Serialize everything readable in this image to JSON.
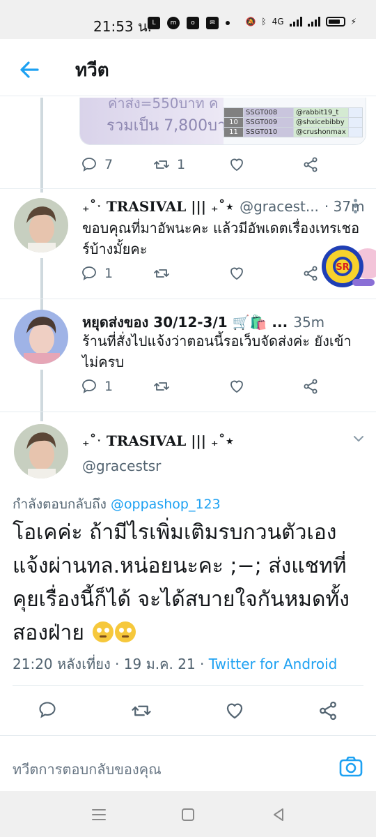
{
  "status_bar": {
    "time": "21:53 น.",
    "network": "4G"
  },
  "app_bar": {
    "title": "ทวีต",
    "back_icon": "arrow-left-icon"
  },
  "media_preview": {
    "text_top": "ค่าส่ง=550บาท ค",
    "text_bottom": "รวมเป็น 7,800บา",
    "rows": [
      {
        "idx": "",
        "code": "SSGT008",
        "user": "@rabbit19_t"
      },
      {
        "idx": "10",
        "code": "SSGT009",
        "user": "@shxicebibby"
      },
      {
        "idx": "11",
        "code": "SSGT010",
        "user": "@crushonmax"
      }
    ]
  },
  "tweets": [
    {
      "actions": {
        "reply": "7",
        "retweet": "1",
        "like": "",
        "share": ""
      }
    },
    {
      "name": "₊˚ˑ TRASIVAL ||| ₊˚⋆",
      "handle": "@gracest...",
      "time": "· 37m",
      "body": "ขอบคุณที่มาอัพนะคะ แล้วมีอัพเดตเรื่องเทรเชอร์บ้างมั้ยคะ",
      "actions": {
        "reply": "1",
        "retweet": "",
        "like": "",
        "share": ""
      }
    },
    {
      "name": "หยุดส่งของ 30/12-3/1 🛒🛍️ ...",
      "handle": "",
      "time": "35m",
      "body": "ร้านที่สั่งไปแจ้งว่าตอนนี้รอเว็บจัดส่งค่ะ ยังเข้าไม่ครบ",
      "actions": {
        "reply": "1",
        "retweet": "",
        "like": "",
        "share": ""
      }
    }
  ],
  "focus_tweet": {
    "name": "₊˚ˑ TRASIVAL ||| ₊˚⋆",
    "handle": "@gracestsr",
    "reply_prefix": "กำลังตอบกลับถึง ",
    "reply_mention": "@oppashop_123",
    "text": "โอเคค่ะ ถ้ามีไรเพิ่มเติมรบกวนตัวเองแจ้งผ่านทล.หน่อยนะคะ ;−; ส่งแชทที่คุยเรื่องนี้ก็ได้ จะได้สบายใจกันหมดทั้งสองฝ่าย",
    "emoji_names": [
      "face-with-rolling-eyes",
      "face-with-rolling-eyes"
    ],
    "timestamp": "21:20 หลังเที่ยง · 19 ม.ค. 21 · ",
    "client": "Twitter for Android"
  },
  "reply_bar": {
    "placeholder": "ทวีตการตอบกลับของคุณ",
    "camera_icon": "camera-icon"
  },
  "nav_bar": {
    "icons": [
      "menu-icon",
      "home-icon",
      "back-icon"
    ]
  },
  "colors": {
    "accent": "#1da1f2",
    "secondary_text": "#536471",
    "divider": "#e6ecf0"
  }
}
